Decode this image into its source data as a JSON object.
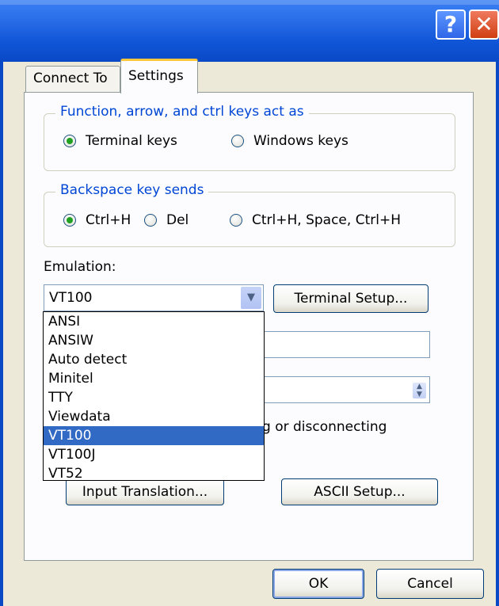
{
  "titlebar": {
    "help_label": "?",
    "close_label": "✕"
  },
  "tabs": [
    {
      "label": "Connect To",
      "active": false
    },
    {
      "label": "Settings",
      "active": true
    }
  ],
  "function_keys_group": {
    "legend": "Function, arrow, and ctrl keys act as",
    "options": [
      {
        "label": "Terminal keys",
        "checked": true
      },
      {
        "label": "Windows keys",
        "checked": false
      }
    ]
  },
  "backspace_group": {
    "legend": "Backspace key sends",
    "options": [
      {
        "label": "Ctrl+H",
        "checked": true
      },
      {
        "label": "Del",
        "checked": false
      },
      {
        "label": "Ctrl+H, Space, Ctrl+H",
        "checked": false
      }
    ]
  },
  "emulation": {
    "label": "Emulation:",
    "selected": "VT100",
    "terminal_setup_label": "Terminal Setup...",
    "options": [
      "ANSI",
      "ANSIW",
      "Auto detect",
      "Minitel",
      "TTY",
      "Viewdata",
      "VT100",
      "VT100J",
      "VT52"
    ]
  },
  "partial_text": {
    "disconnect_fragment": "g or disconnecting"
  },
  "buttons": {
    "input_translation": "Input Translation...",
    "ascii_setup": "ASCII Setup...",
    "ok": "OK",
    "cancel": "Cancel"
  },
  "colors": {
    "titlebar_blue": "#0a49c6",
    "legend_blue": "#0046d5",
    "radio_green": "#21a121",
    "selection_blue": "#316ac5",
    "dialog_bg": "#ece9d8"
  }
}
